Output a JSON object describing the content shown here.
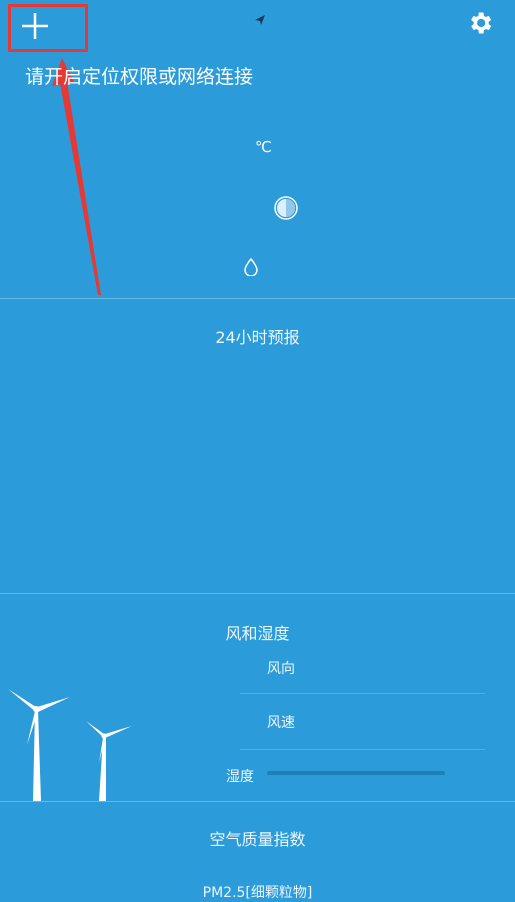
{
  "header": {
    "add_icon": "plus-icon",
    "settings_icon": "gear-icon",
    "location_icon": "location-arrow-icon",
    "highlight_color": "#e53935"
  },
  "weather": {
    "message": "请开启定位权限或网络连接",
    "temp_unit": "℃",
    "condition_icon": "weather-condition-icon",
    "humidity_icon": "water-drop-icon"
  },
  "sections": {
    "forecast_title": "24小时预报",
    "wind_title": "风和湿度",
    "wind_direction_label": "风向",
    "wind_speed_label": "风速",
    "humidity_label": "湿度",
    "aqi_title": "空气质量指数",
    "pm25_label": "PM2.5[细颗粒物]"
  },
  "colors": {
    "background": "#2c9bd9",
    "humidity_track": "#1f7fb8"
  }
}
